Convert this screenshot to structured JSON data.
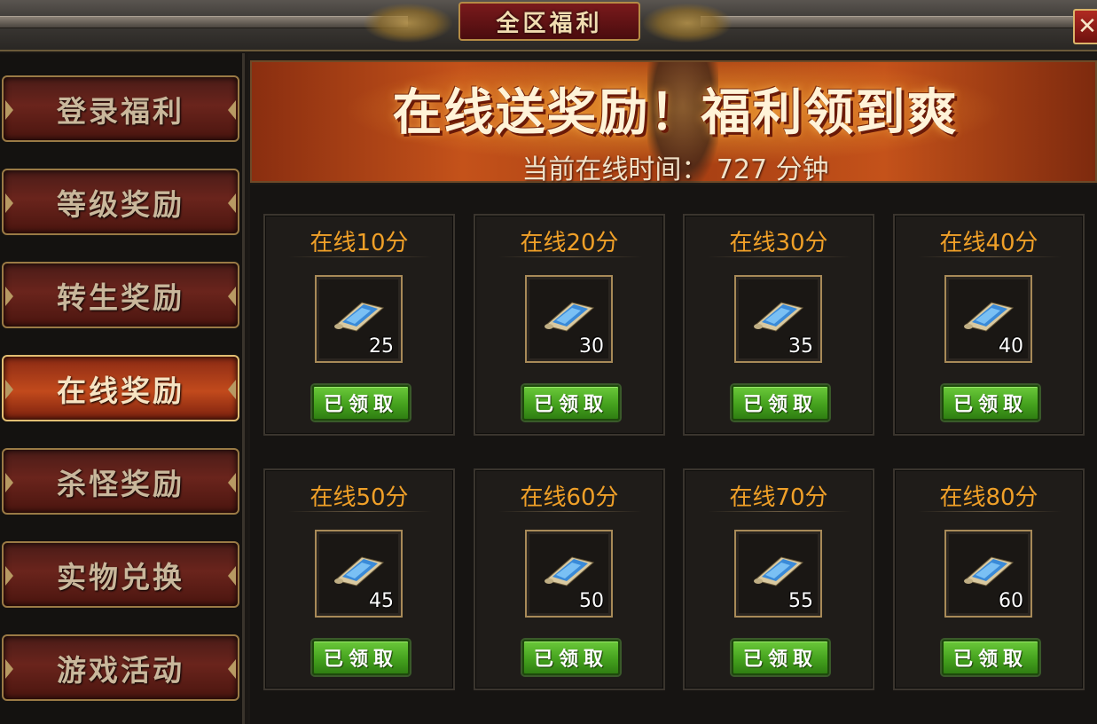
{
  "window": {
    "title": "全区福利",
    "close_label": "✕"
  },
  "sidebar": {
    "items": [
      {
        "label": "登录福利"
      },
      {
        "label": "等级奖励"
      },
      {
        "label": "转生奖励"
      },
      {
        "label": "在线奖励",
        "active": true
      },
      {
        "label": "杀怪奖励"
      },
      {
        "label": "实物兑换"
      },
      {
        "label": "游戏活动"
      }
    ]
  },
  "banner": {
    "headline": "在线送奖励！福利领到爽",
    "online_time_text": "当前在线时间： 727 分钟"
  },
  "rewards": [
    {
      "title": "在线10分",
      "count": "25",
      "item_icon": "scroll-icon",
      "button": "已领取"
    },
    {
      "title": "在线20分",
      "count": "30",
      "item_icon": "scroll-icon",
      "button": "已领取"
    },
    {
      "title": "在线30分",
      "count": "35",
      "item_icon": "scroll-icon",
      "button": "已领取"
    },
    {
      "title": "在线40分",
      "count": "40",
      "item_icon": "scroll-icon",
      "button": "已领取"
    },
    {
      "title": "在线50分",
      "count": "45",
      "item_icon": "scroll-icon",
      "button": "已领取"
    },
    {
      "title": "在线60分",
      "count": "50",
      "item_icon": "scroll-icon",
      "button": "已领取"
    },
    {
      "title": "在线70分",
      "count": "55",
      "item_icon": "scroll-icon",
      "button": "已领取"
    },
    {
      "title": "在线80分",
      "count": "60",
      "item_icon": "scroll-icon",
      "button": "已领取"
    }
  ],
  "colors": {
    "reward_title": "#f0a028",
    "claimed_button": "#45a21e",
    "active_tab": "#c24a1c"
  }
}
